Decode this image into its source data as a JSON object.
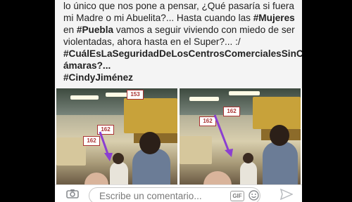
{
  "post": {
    "line1": "lo único que nos pone a pensar, ¿Qué pasaría si fuera",
    "line2": "mi Madre o mi Abuelita?... Hasta cuando las ",
    "line2_tag": "#Mujeres",
    "line3_pre": "en ",
    "line3_tag": "#Puebla",
    "line3_post": " vamos a seguir viviendo con miedo de ser",
    "line4": "violentadas, ahora hasta en el Super?... :/",
    "line5": "#CuálEsLaSeguridadDeLosCentrosComercialesSinC",
    "line6": "ámaras?...",
    "line7": "#CindyJiménez"
  },
  "photos": {
    "left": {
      "sign_a": "153",
      "sign_b": "162",
      "sign_c": "162"
    },
    "right": {
      "sign_a": "162",
      "sign_b": "162"
    }
  },
  "composer": {
    "placeholder": "Escribe un comentario...",
    "gif_label": "GIF"
  },
  "icons": [
    "camera-icon",
    "gif-icon",
    "emoji-icon",
    "send-icon"
  ]
}
